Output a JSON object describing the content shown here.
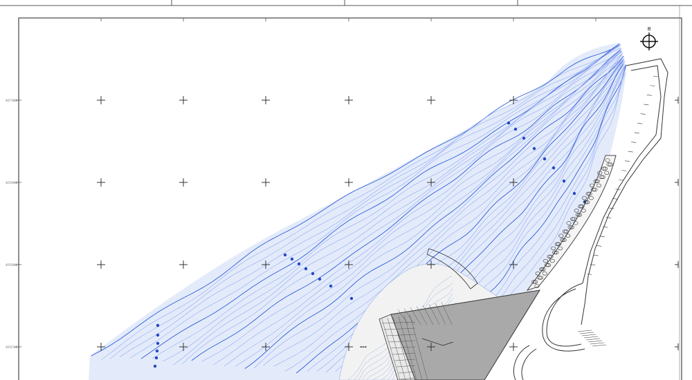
{
  "map": {
    "north_arrow": {
      "letter": "B"
    },
    "grid": {
      "rows": 4,
      "cols": 6,
      "style": "crosshairs"
    },
    "left_margin_tick_labels": [
      "4877000",
      "4876900",
      "4876800",
      "4876700"
    ],
    "colors": {
      "contour": "#2e5bd8",
      "contour_light": "#8aa2ee",
      "contour_fill": "#e3ebfb",
      "land_contour": "#9ab0e6",
      "land_fill": "#f1f1f1",
      "pier_fill": "#a9a9a9",
      "breakwater": "#444444",
      "frame": "#555555",
      "crosshair": "#333333"
    },
    "features": [
      "north-arrow-icon",
      "bathymetric-contours",
      "rock-breakwater",
      "pier-platform",
      "coastal-road",
      "sampling-points"
    ]
  }
}
